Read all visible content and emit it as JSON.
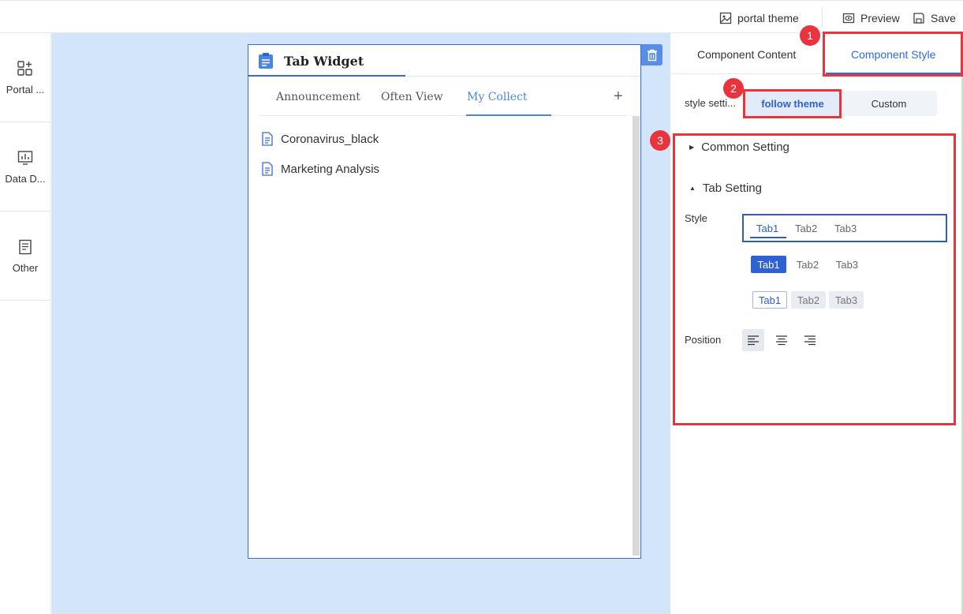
{
  "topbar": {
    "portal_theme": "portal theme",
    "preview": "Preview",
    "save": "Save"
  },
  "sidebar": {
    "items": [
      {
        "label": "Portal ...",
        "icon": "grid-plus-icon"
      },
      {
        "label": "Data D...",
        "icon": "chart-icon"
      },
      {
        "label": "Other",
        "icon": "document-icon"
      }
    ]
  },
  "widget": {
    "title": "Tab Widget",
    "tabs": [
      "Announcement",
      "Often View",
      "My Collect"
    ],
    "active_tab": "My Collect",
    "add": "+",
    "items": [
      "Coronavirus_black",
      "Marketing Analysis"
    ]
  },
  "panel": {
    "tabs": [
      "Component Content",
      "Component Style"
    ],
    "active_tab": "Component Style",
    "style_setting_label": "style setti...",
    "style_options": [
      "follow theme",
      "Custom"
    ],
    "selected_style_option": "follow theme",
    "sections": {
      "common": "Common Setting",
      "tab": "Tab Setting"
    },
    "style_label": "Style",
    "position_label": "Position",
    "tab_style_samples": [
      "Tab1",
      "Tab2",
      "Tab3"
    ],
    "selected_position": "left"
  },
  "annotations": {
    "badges": [
      "1",
      "2",
      "3"
    ],
    "color": "#e9333d"
  },
  "colors": {
    "accent": "#2f6bd6",
    "canvas": "#d3e5fb"
  }
}
